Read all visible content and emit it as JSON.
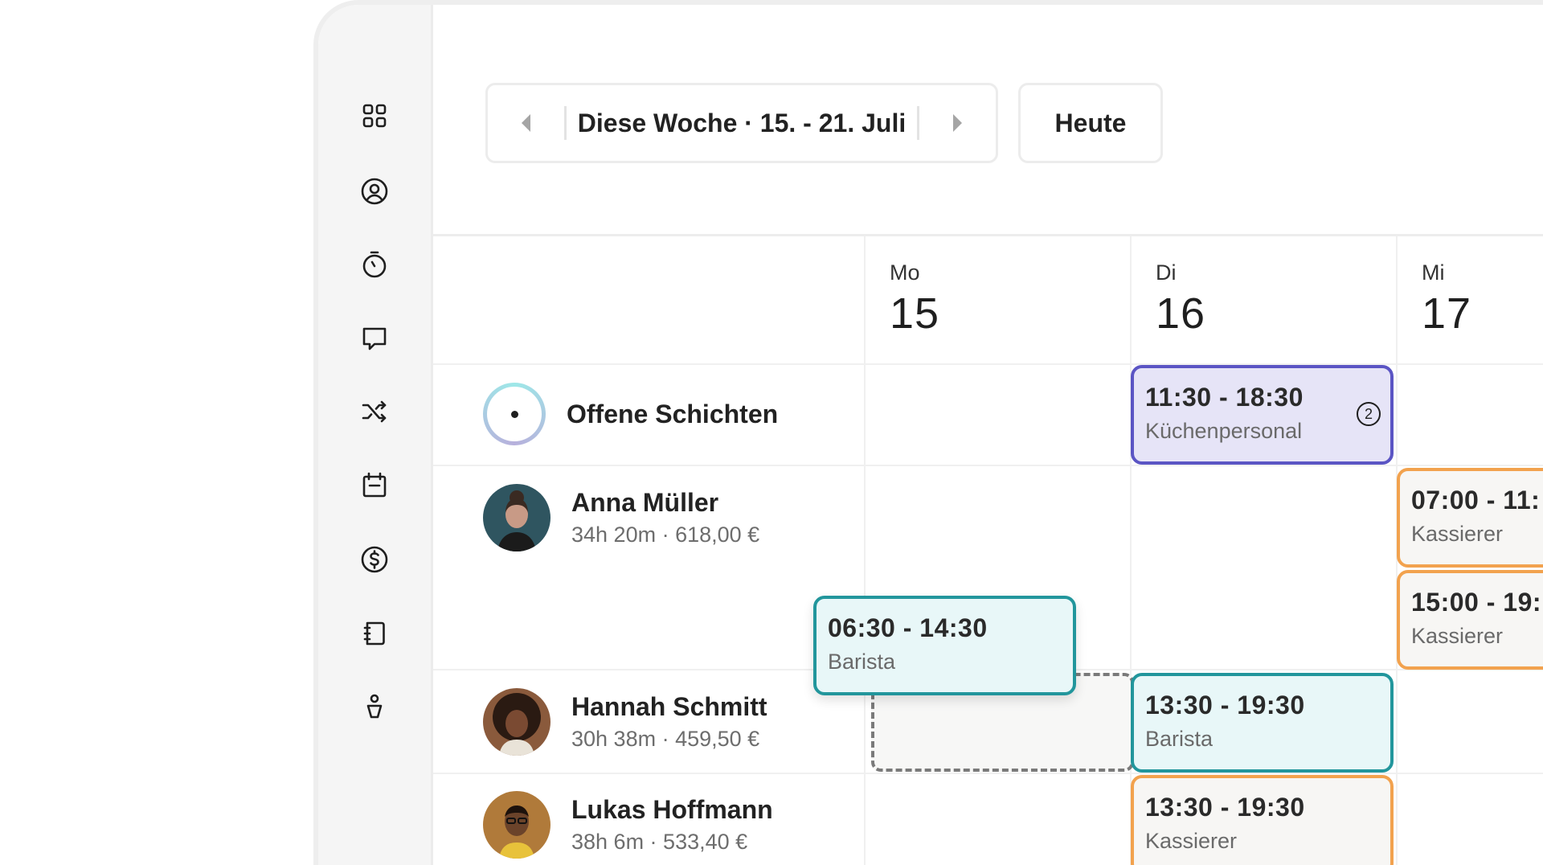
{
  "sidebar": {
    "items": [
      {
        "icon": "grid-icon"
      },
      {
        "icon": "user-circle-icon"
      },
      {
        "icon": "stopwatch-icon"
      },
      {
        "icon": "chat-icon"
      },
      {
        "icon": "shuffle-icon"
      },
      {
        "icon": "calendar-icon"
      },
      {
        "icon": "dollar-icon"
      },
      {
        "icon": "notebook-icon"
      },
      {
        "icon": "person-icon"
      }
    ]
  },
  "toolbar": {
    "week_label": "Diese Woche · 15. - 21. Juli",
    "today_label": "Heute"
  },
  "days": [
    {
      "name": "Mo",
      "num": "15"
    },
    {
      "name": "Di",
      "num": "16"
    },
    {
      "name": "Mi",
      "num": "17"
    }
  ],
  "open_shifts": {
    "label": "Offene Schichten"
  },
  "employees": [
    {
      "name": "Anna Müller",
      "stats": "34h 20m · 618,00 €"
    },
    {
      "name": "Hannah Schmitt",
      "stats": "30h 38m · 459,50 €"
    },
    {
      "name": "Lukas Hoffmann",
      "stats": "38h 6m · 533,40 €"
    }
  ],
  "shifts": {
    "open_di": {
      "time": "11:30 - 18:30",
      "role": "Küchenpersonal",
      "count": "2"
    },
    "anna_mi_1": {
      "time": "07:00 - 11:",
      "role": "Kassierer"
    },
    "anna_mi_2": {
      "time": "15:00 - 19:",
      "role": "Kassierer"
    },
    "dragging": {
      "time": "06:30 - 14:30",
      "role": "Barista"
    },
    "hannah_di": {
      "time": "13:30 - 19:30",
      "role": "Barista"
    },
    "lukas_di": {
      "time": "13:30 - 19:30",
      "role": "Kassierer"
    }
  },
  "colors": {
    "teal": "#22969c",
    "purple": "#5b55c4",
    "orange": "#f2a24e"
  }
}
